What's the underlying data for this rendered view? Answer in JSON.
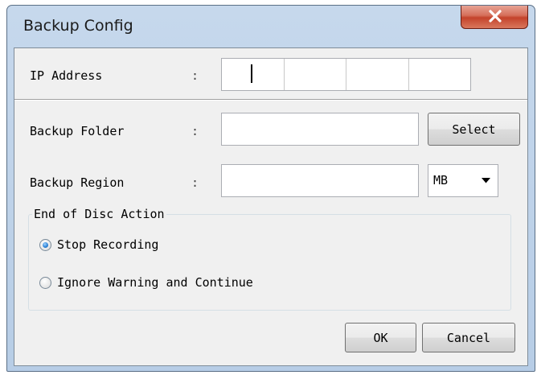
{
  "window": {
    "title": "Backup Config"
  },
  "form": {
    "ip_address": {
      "label": "IP Address",
      "colon": ":",
      "octets": [
        "",
        "",
        "",
        ""
      ]
    },
    "backup_folder": {
      "label": "Backup Folder",
      "colon": ":",
      "value": "",
      "select_label": "Select"
    },
    "backup_region": {
      "label": "Backup Region",
      "colon": ":",
      "value": "",
      "unit": "MB"
    }
  },
  "end_action": {
    "title": "End of Disc Action",
    "options": [
      {
        "label": "Stop Recording",
        "checked": true
      },
      {
        "label": "Ignore Warning and Continue",
        "checked": false
      }
    ]
  },
  "buttons": {
    "ok": "OK",
    "cancel": "Cancel"
  },
  "icons": {
    "close": "close-icon",
    "dropdown": "chevron-down-icon"
  },
  "colors": {
    "title_bar": "#c6d8ec",
    "close_button": "#c4432b",
    "dialog_background": "#f0f0f0"
  }
}
